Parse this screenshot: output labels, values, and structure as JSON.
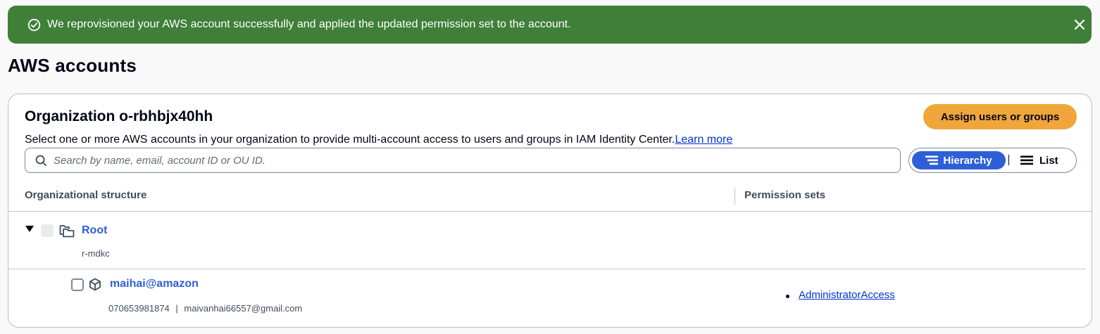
{
  "flash": {
    "message": "We reprovisioned your AWS account successfully and applied the updated permission set to the account.",
    "icon": "check-circle-icon",
    "close_icon": "close-icon",
    "color": "#3f7f38"
  },
  "page": {
    "title": "AWS accounts"
  },
  "organization": {
    "title": "Organization o-rbhbjx40hh",
    "description": "Select one or more AWS accounts in your organization to provide multi-account access to users and groups in IAM Identity Center.",
    "learn_more": "Learn more",
    "assign_button": "Assign users or groups",
    "accent": "#f0a63a"
  },
  "search": {
    "placeholder": "Search by name, email, account ID or OU ID."
  },
  "view_toggle": {
    "hierarchy": "Hierarchy",
    "list": "List",
    "selected": "Hierarchy"
  },
  "table": {
    "columns": [
      "Organizational structure",
      "Permission sets"
    ],
    "root": {
      "name": "Root",
      "id": "r-mdkc",
      "expanded": true
    },
    "accounts": [
      {
        "name": "maihai@amazon",
        "account_id": "070653981874",
        "separator": "|",
        "email": "maivanhai66557@gmail.com",
        "permission_sets": [
          "AdministratorAccess"
        ]
      }
    ]
  }
}
